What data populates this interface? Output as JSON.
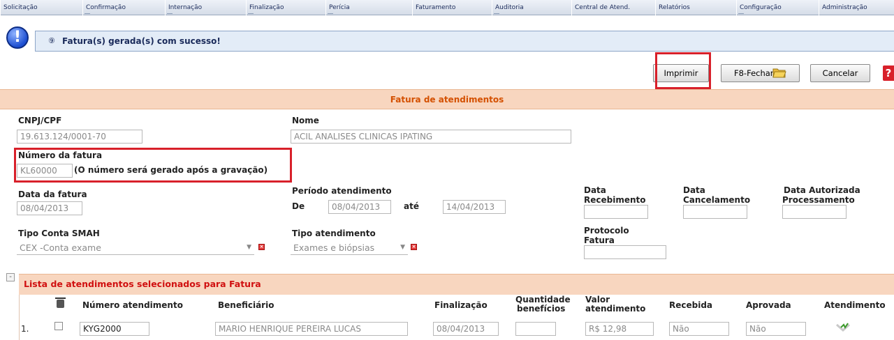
{
  "menu": [
    {
      "label": "Solicitação"
    },
    {
      "label": "Confirmação"
    },
    {
      "label": "Internação"
    },
    {
      "label": "Finalização"
    },
    {
      "label": "Perícia"
    },
    {
      "label": "Faturamento"
    },
    {
      "label": "Auditoria"
    },
    {
      "label": "Central de Atend."
    },
    {
      "label": "Relatórios"
    },
    {
      "label": "Configuração"
    },
    {
      "label": "Administração"
    }
  ],
  "message": {
    "icon_glyph": "!",
    "inline_glyph": "⑨",
    "text": "Fatura(s) gerada(s) com sucesso!"
  },
  "toolbar": {
    "print_label": "Imprimir",
    "close_label": "F8-Fechar",
    "cancel_label": "Cancelar",
    "help_label": "?"
  },
  "section": {
    "title": "Fatura de atendimentos"
  },
  "form": {
    "cnpj_label": "CNPJ/CPF",
    "cnpj_value": "19.613.124/0001-70",
    "nome_label": "Nome",
    "nome_value": "ACIL ANALISES CLINICAS IPATING",
    "numero_label": "Número da fatura",
    "numero_value": "KL60000",
    "numero_hint": "(O número será gerado após a gravação)",
    "data_fatura_label": "Data da fatura",
    "data_fatura_value": "08/04/2013",
    "periodo_label": "Período atendimento",
    "de_label": "De",
    "de_value": "08/04/2013",
    "ate_label": "até",
    "ate_value": "14/04/2013",
    "data_receb_label_1": "Data",
    "data_receb_label_2": "Recebimento",
    "data_canc_label_1": "Data",
    "data_canc_label_2": "Cancelamento",
    "data_aut_label_1": "Data Autorizada",
    "data_aut_label_2": "Processamento",
    "tipo_conta_label": "Tipo Conta SMAH",
    "tipo_conta_value": "CEX -Conta exame",
    "tipo_atend_label": "Tipo atendimento",
    "tipo_atend_value": "Exames e biópsias",
    "protocolo_label_1": "Protocolo",
    "protocolo_label_2": "Fatura"
  },
  "list": {
    "collapse_glyph": "-",
    "title": "Lista de atendimentos selecionados para Fatura",
    "columns": {
      "numero": "Número atendimento",
      "beneficiario": "Beneficiário",
      "finalizacao": "Finalização",
      "quantidade_1": "Quantidade",
      "quantidade_2": "benefícios",
      "valor_1": "Valor",
      "valor_2": "atendimento",
      "recebida": "Recebida",
      "aprovada": "Aprovada",
      "atendimento": "Atendimento"
    },
    "rows": [
      {
        "index": "1.",
        "numero": "KYG2000",
        "beneficiario": "MARIO HENRIQUE PEREIRA LUCAS",
        "finalizacao": "08/04/2013",
        "quantidade": "",
        "valor": "R$ 12,98",
        "recebida": "Não",
        "aprovada": "Não"
      }
    ]
  },
  "colors": {
    "accent_orange": "#d45000",
    "highlight_red": "#d8202a",
    "section_bg": "#f8d6bf"
  }
}
